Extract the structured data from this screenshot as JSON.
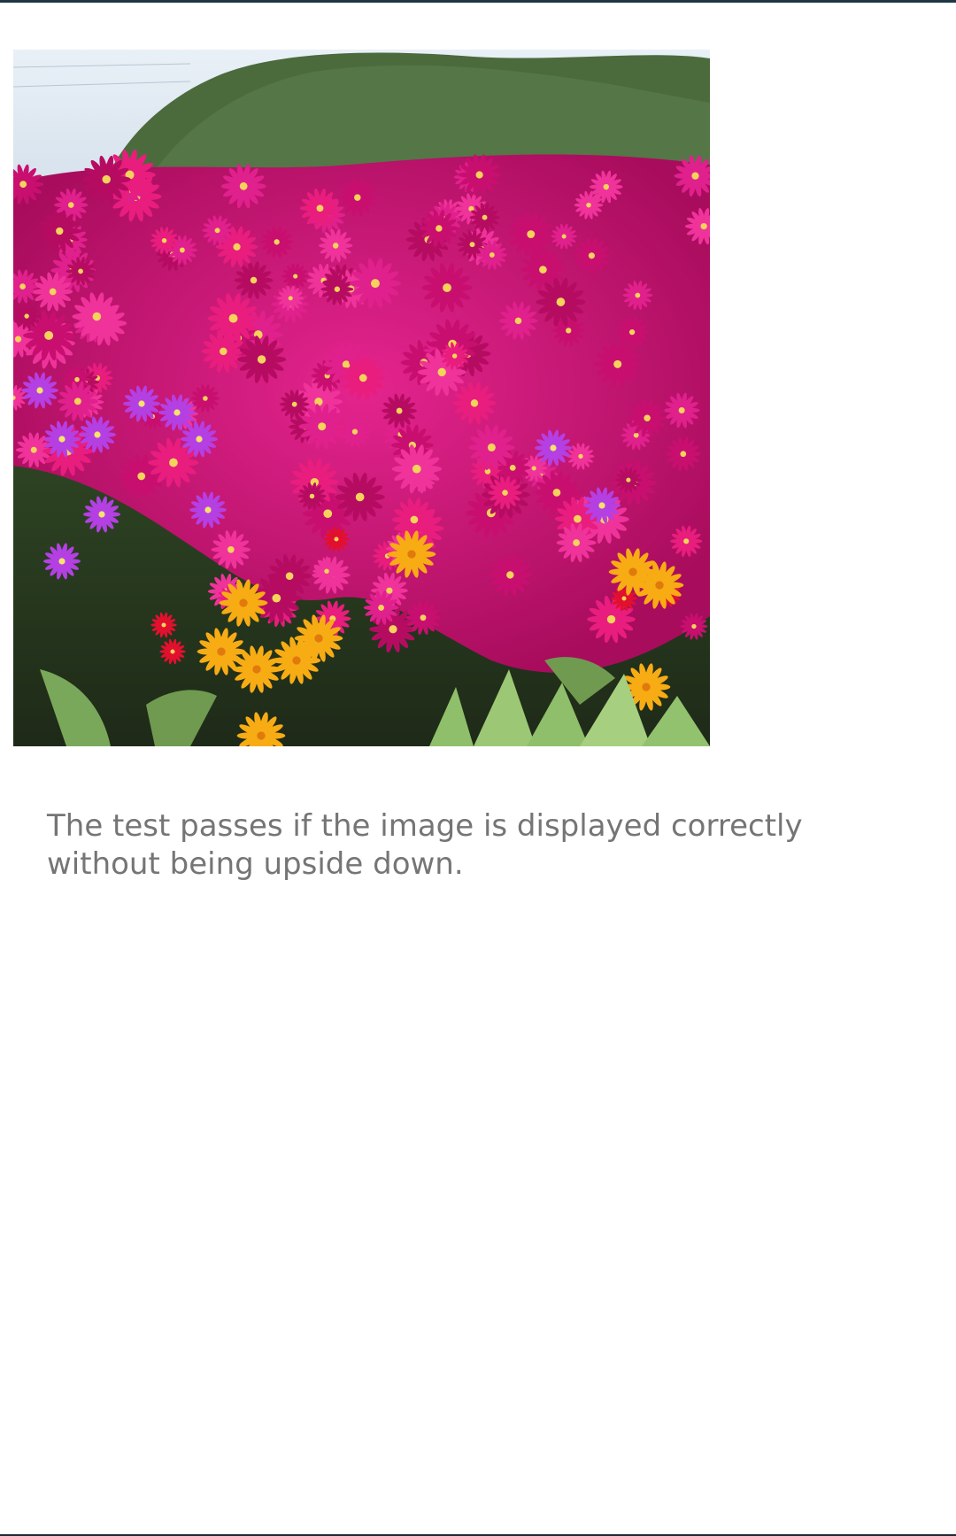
{
  "page": {
    "caption": "The test passes if the image is displayed correctly without being upside down."
  },
  "photo": {
    "subject": "flower-field-photo",
    "colors": {
      "sky": "#dfe9f2",
      "shrub": "#4a6a3c",
      "magenta": "#d0107a",
      "purple": "#b640e0",
      "yellow": "#f6b21a",
      "foliage": "#2f4a25"
    }
  }
}
